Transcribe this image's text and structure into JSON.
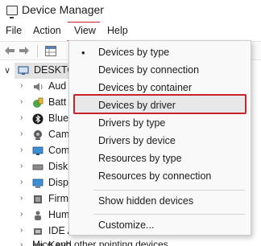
{
  "window": {
    "title": "Device Manager"
  },
  "menubar": {
    "file": "File",
    "action": "Action",
    "view": "View",
    "help": "Help"
  },
  "tree": {
    "root_label": "DESKTO",
    "items": [
      {
        "label": "Aud",
        "icon": "speaker-icon"
      },
      {
        "label": "Batt",
        "icon": "battery-icon"
      },
      {
        "label": "Blue",
        "icon": "bluetooth-icon"
      },
      {
        "label": "Cam",
        "icon": "camera-icon"
      },
      {
        "label": "Com",
        "icon": "computer-icon"
      },
      {
        "label": "Disk",
        "icon": "disk-drive-icon"
      },
      {
        "label": "Disp",
        "icon": "display-icon"
      },
      {
        "label": "Firm",
        "icon": "firmware-icon"
      },
      {
        "label": "Hum",
        "icon": "human-interface-icon"
      },
      {
        "label": "IDE A",
        "icon": "ide-controller-icon"
      },
      {
        "label": "Keyb",
        "icon": "keyboard-icon"
      }
    ],
    "bottom_row": "Mice and other pointing devices"
  },
  "view_menu": {
    "items": [
      {
        "label": "Devices by type",
        "checked": true
      },
      {
        "label": "Devices by connection"
      },
      {
        "label": "Devices by container"
      },
      {
        "label": "Devices by driver",
        "highlighted": true
      },
      {
        "label": "Drivers by type"
      },
      {
        "label": "Drivers by device"
      },
      {
        "label": "Resources by type"
      },
      {
        "label": "Resources by connection"
      }
    ],
    "show_hidden": "Show hidden devices",
    "customize": "Customize..."
  },
  "colors": {
    "highlight_border": "#c8232c",
    "menu_bg": "#f9f9f9"
  }
}
